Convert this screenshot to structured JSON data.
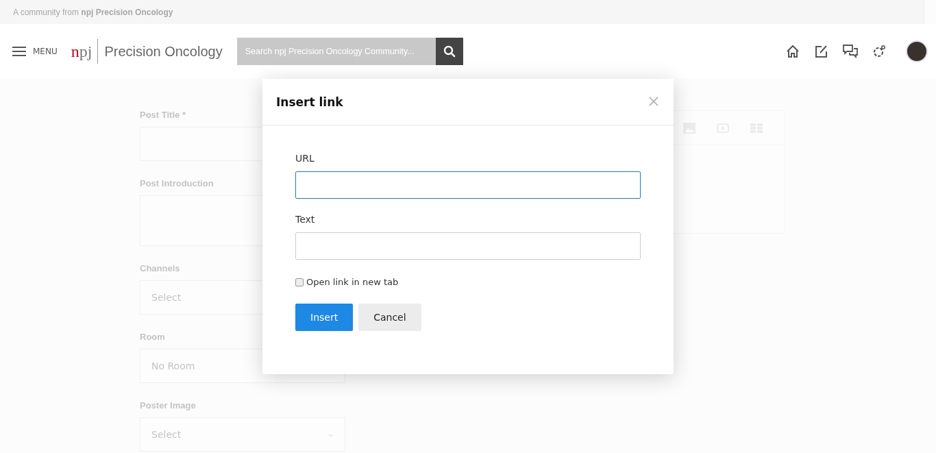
{
  "banner": {
    "text": "A community from **npj Precision Oncology**"
  },
  "header": {
    "menu_label": "MENU",
    "logo_mark": "npj",
    "logo_name": "Precision Oncology",
    "search": {
      "placeholder": "Search npj Precision Oncology Community..."
    }
  },
  "form": {
    "fields": [
      {
        "kind": "text",
        "label": "Post Title *"
      },
      {
        "kind": "textarea",
        "label": "Post Introduction"
      },
      {
        "kind": "select",
        "label": "Channels",
        "placeholder": "Select"
      },
      {
        "kind": "select",
        "label": "Room",
        "value": "No Room"
      },
      {
        "kind": "select",
        "label": "Poster Image",
        "placeholder": "Select"
      }
    ]
  },
  "dialog": {
    "title": "Insert link",
    "fields": [
      {
        "label": "URL",
        "focused": true
      },
      {
        "label": "Text",
        "focused": false
      }
    ],
    "checkbox": {
      "label": "Open link in new tab",
      "checked": false
    },
    "buttons": [
      {
        "label": "Insert",
        "kind": "primary"
      },
      {
        "label": "Cancel",
        "kind": "secondary"
      }
    ]
  }
}
